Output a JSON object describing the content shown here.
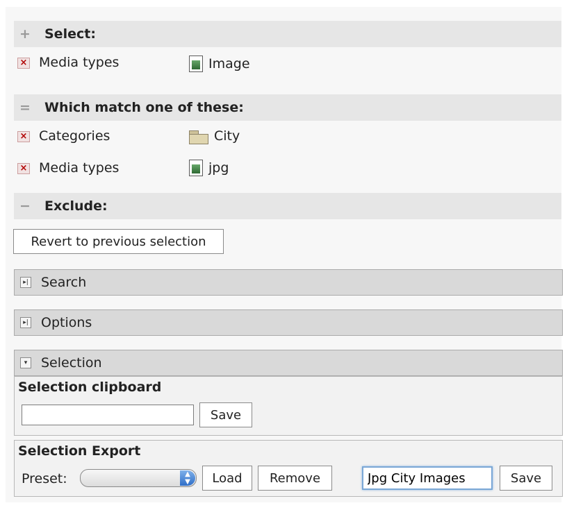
{
  "select_section": {
    "title": "Select:",
    "op_symbol": "+",
    "rows": [
      {
        "remove": "×",
        "label": "Media types",
        "value": "Image",
        "icon": "image-file-icon"
      }
    ]
  },
  "match_section": {
    "title": "Which match one of these:",
    "op_symbol": "=",
    "rows": [
      {
        "remove": "×",
        "label": "Categories",
        "value": "City",
        "icon": "folder-icon"
      },
      {
        "remove": "×",
        "label": "Media types",
        "value": "jpg",
        "icon": "image-file-icon"
      }
    ]
  },
  "exclude_section": {
    "title": "Exclude:",
    "op_symbol": "−"
  },
  "revert_button": "Revert to previous selection",
  "search_bar": {
    "label": "Search",
    "toggle": "▸|",
    "icon": "expand-icon"
  },
  "options_bar": {
    "label": "Options",
    "toggle": "▸|",
    "icon": "expand-icon"
  },
  "selection_bar": {
    "label": "Selection",
    "toggle": "▾",
    "icon": "collapse-icon"
  },
  "clipboard": {
    "title": "Selection clipboard",
    "input_value": "",
    "save_label": "Save"
  },
  "export": {
    "title": "Selection Export",
    "preset_label": "Preset:",
    "preset_value": "",
    "load_label": "Load",
    "remove_label": "Remove",
    "name_value": "Jpg City Images",
    "save_label": "Save"
  },
  "colors": {
    "section_bg": "#e6e6e6",
    "bar_bg": "#d9d9d9",
    "remove_red": "#b10000",
    "focus_blue": "#7aa7d6"
  }
}
